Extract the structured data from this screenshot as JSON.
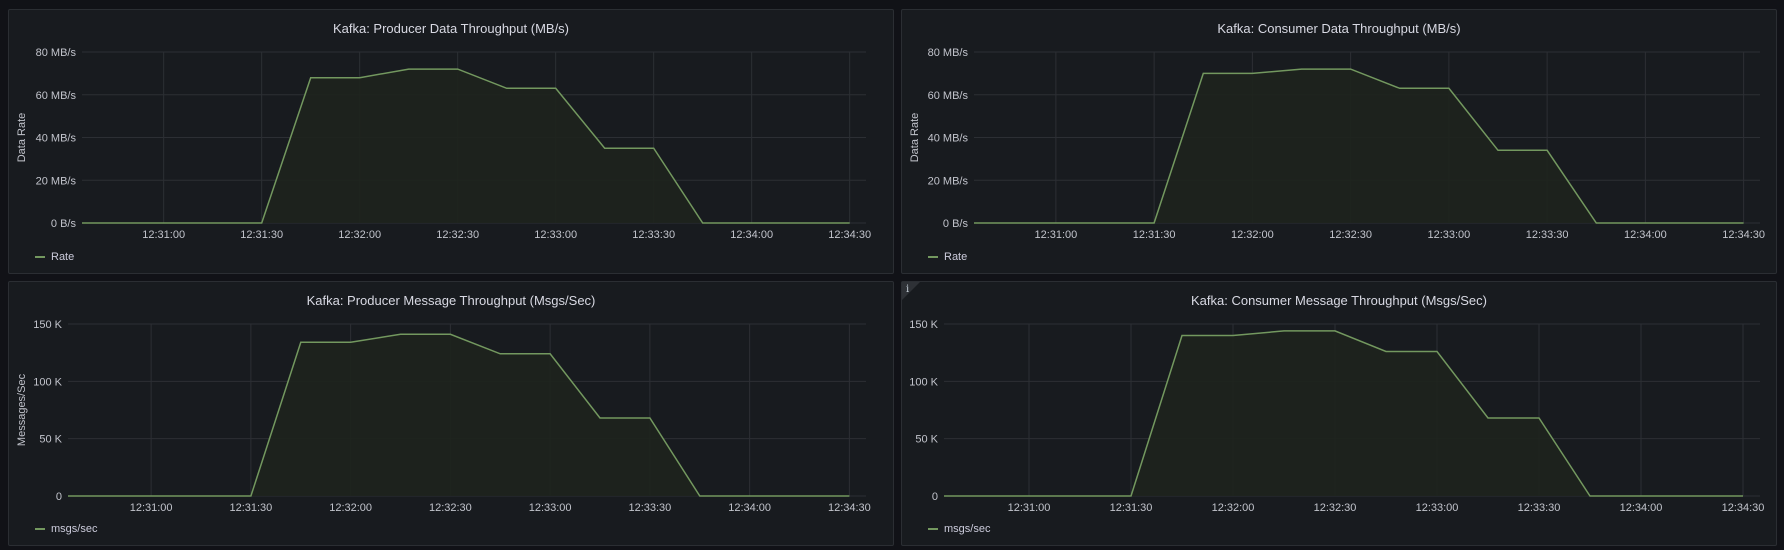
{
  "colors": {
    "background": "#111217",
    "panel": "#181b1f",
    "series_line": "#73985f",
    "series_fill": "#1e241d",
    "grid": "#2c2f34"
  },
  "panels": [
    {
      "title": "Kafka: Producer Data Throughput (MB/s)",
      "legend": "Rate",
      "ylabel": "Data Rate",
      "info_icon": false
    },
    {
      "title": "Kafka: Consumer Data Throughput (MB/s)",
      "legend": "Rate",
      "ylabel": "Data Rate",
      "info_icon": false
    },
    {
      "title": "Kafka: Producer Message Throughput (Msgs/Sec)",
      "legend": "msgs/sec",
      "ylabel": "Messages/Sec",
      "info_icon": false
    },
    {
      "title": "Kafka: Consumer Message Throughput (Msgs/Sec)",
      "legend": "msgs/sec",
      "ylabel": "",
      "info_icon": true,
      "info_icon_glyph": "i"
    }
  ],
  "chart_data": [
    {
      "type": "area",
      "title": "Kafka: Producer Data Throughput (MB/s)",
      "ylabel": "Data Rate",
      "xlabel": "",
      "xlim": [
        "12:30:35",
        "12:34:35"
      ],
      "xticks": [
        "12:31:00",
        "12:31:30",
        "12:32:00",
        "12:32:30",
        "12:33:00",
        "12:33:30",
        "12:34:00",
        "12:34:30"
      ],
      "ylim": [
        0,
        80
      ],
      "yticks": [
        0,
        20,
        40,
        60,
        80
      ],
      "ytick_labels": [
        "0 B/s",
        "20 MB/s",
        "40 MB/s",
        "60 MB/s",
        "80 MB/s"
      ],
      "grid": true,
      "legend_position": "bottom-left",
      "series": [
        {
          "name": "Rate",
          "x": [
            "12:30:35",
            "12:31:30",
            "12:31:45",
            "12:32:00",
            "12:32:15",
            "12:32:30",
            "12:32:45",
            "12:33:00",
            "12:33:15",
            "12:33:30",
            "12:33:45",
            "12:34:00",
            "12:34:30"
          ],
          "y": [
            0,
            0,
            68,
            68,
            72,
            72,
            63,
            63,
            35,
            35,
            0,
            0,
            0
          ]
        }
      ]
    },
    {
      "type": "area",
      "title": "Kafka: Consumer Data Throughput (MB/s)",
      "ylabel": "Data Rate",
      "xlabel": "",
      "xlim": [
        "12:30:35",
        "12:34:35"
      ],
      "xticks": [
        "12:31:00",
        "12:31:30",
        "12:32:00",
        "12:32:30",
        "12:33:00",
        "12:33:30",
        "12:34:00",
        "12:34:30"
      ],
      "ylim": [
        0,
        80
      ],
      "yticks": [
        0,
        20,
        40,
        60,
        80
      ],
      "ytick_labels": [
        "0 B/s",
        "20 MB/s",
        "40 MB/s",
        "60 MB/s",
        "80 MB/s"
      ],
      "grid": true,
      "legend_position": "bottom-left",
      "series": [
        {
          "name": "Rate",
          "x": [
            "12:30:35",
            "12:31:30",
            "12:31:45",
            "12:32:00",
            "12:32:15",
            "12:32:30",
            "12:32:45",
            "12:33:00",
            "12:33:15",
            "12:33:30",
            "12:33:45",
            "12:34:00",
            "12:34:30"
          ],
          "y": [
            0,
            0,
            70,
            70,
            72,
            72,
            63,
            63,
            34,
            34,
            0,
            0,
            0
          ]
        }
      ]
    },
    {
      "type": "area",
      "title": "Kafka: Producer Message Throughput (Msgs/Sec)",
      "ylabel": "Messages/Sec",
      "xlabel": "",
      "xlim": [
        "12:30:35",
        "12:34:35"
      ],
      "xticks": [
        "12:31:00",
        "12:31:30",
        "12:32:00",
        "12:32:30",
        "12:33:00",
        "12:33:30",
        "12:34:00",
        "12:34:30"
      ],
      "ylim": [
        0,
        150000
      ],
      "yticks": [
        0,
        50000,
        100000,
        150000
      ],
      "ytick_labels": [
        "0",
        "50 K",
        "100 K",
        "150 K"
      ],
      "grid": true,
      "legend_position": "bottom-left",
      "series": [
        {
          "name": "msgs/sec",
          "x": [
            "12:30:35",
            "12:31:30",
            "12:31:45",
            "12:32:00",
            "12:32:15",
            "12:32:30",
            "12:32:45",
            "12:33:00",
            "12:33:15",
            "12:33:30",
            "12:33:45",
            "12:34:00",
            "12:34:30"
          ],
          "y": [
            0,
            0,
            134000,
            134000,
            141000,
            141000,
            124000,
            124000,
            68000,
            68000,
            0,
            0,
            0
          ]
        }
      ]
    },
    {
      "type": "area",
      "title": "Kafka: Consumer Message Throughput (Msgs/Sec)",
      "ylabel": "",
      "xlabel": "",
      "xlim": [
        "12:30:35",
        "12:34:35"
      ],
      "xticks": [
        "12:31:00",
        "12:31:30",
        "12:32:00",
        "12:32:30",
        "12:33:00",
        "12:33:30",
        "12:34:00",
        "12:34:30"
      ],
      "ylim": [
        0,
        150000
      ],
      "yticks": [
        0,
        50000,
        100000,
        150000
      ],
      "ytick_labels": [
        "0",
        "50 K",
        "100 K",
        "150 K"
      ],
      "grid": true,
      "legend_position": "bottom-left",
      "series": [
        {
          "name": "msgs/sec",
          "x": [
            "12:30:35",
            "12:31:30",
            "12:31:45",
            "12:32:00",
            "12:32:15",
            "12:32:30",
            "12:32:45",
            "12:33:00",
            "12:33:15",
            "12:33:30",
            "12:33:45",
            "12:34:00",
            "12:34:30"
          ],
          "y": [
            0,
            0,
            140000,
            140000,
            144000,
            144000,
            126000,
            126000,
            68000,
            68000,
            0,
            0,
            0
          ]
        }
      ]
    }
  ]
}
